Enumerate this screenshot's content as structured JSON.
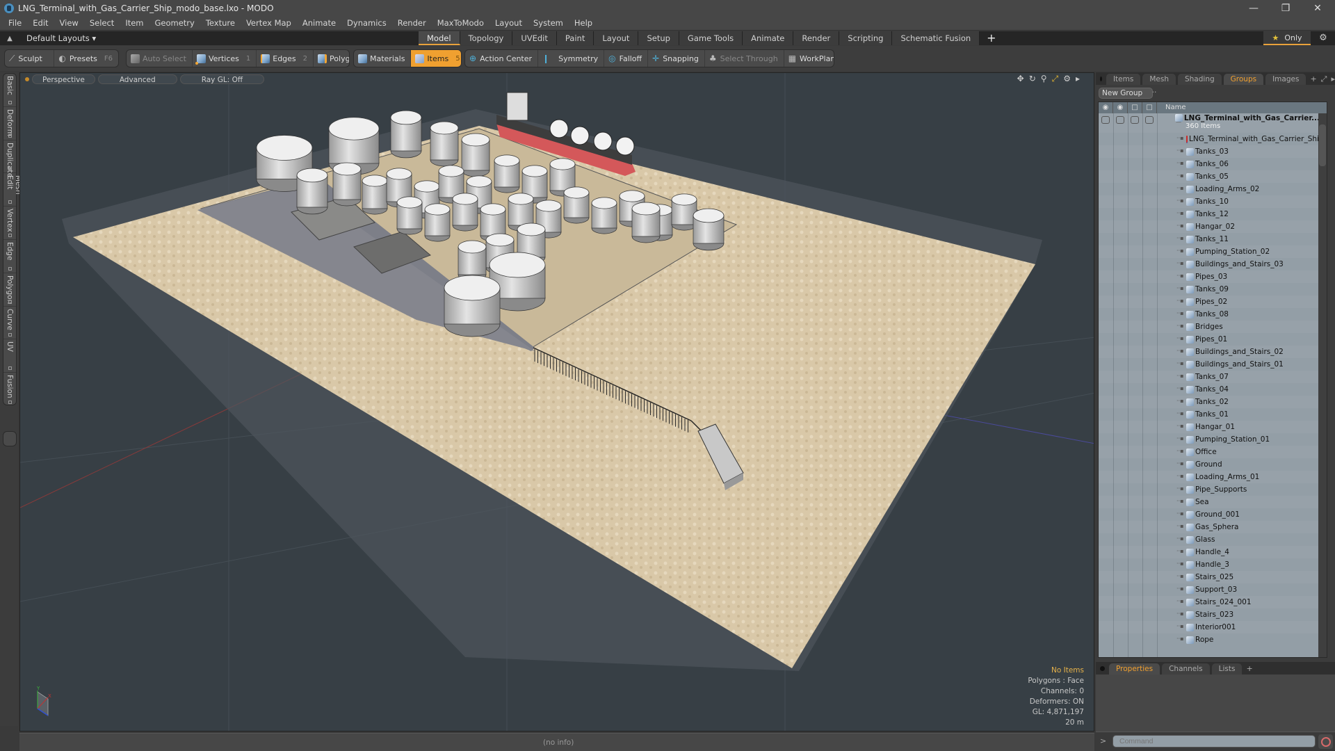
{
  "window": {
    "title": "LNG_Terminal_with_Gas_Carrier_Ship_modo_base.lxo - MODO",
    "controls": [
      "minimize",
      "restore",
      "close"
    ]
  },
  "menu": [
    "File",
    "Edit",
    "View",
    "Select",
    "Item",
    "Geometry",
    "Texture",
    "Vertex Map",
    "Animate",
    "Dynamics",
    "Render",
    "MaxToModo",
    "Layout",
    "System",
    "Help"
  ],
  "layout_bar": {
    "layouts_label": "Default Layouts",
    "tabs": [
      "Model",
      "Topology",
      "UVEdit",
      "Paint",
      "Layout",
      "Setup",
      "Game Tools",
      "Animate",
      "Render",
      "Scripting",
      "Schematic Fusion"
    ],
    "active_tab": "Model",
    "only_label": "Only"
  },
  "toolbar": {
    "sculpt": "Sculpt",
    "presets": "Presets",
    "presets_key": "F6",
    "auto_select": "Auto Select",
    "vertices": "Vertices",
    "vertices_key": "1",
    "edges": "Edges",
    "edges_key": "2",
    "polygons": "Polygons",
    "materials": "Materials",
    "items": "Items",
    "items_key": "5",
    "action_center": "Action Center",
    "symmetry": "Symmetry",
    "falloff": "Falloff",
    "snapping": "Snapping",
    "select_through": "Select Through",
    "workplane": "WorkPlane"
  },
  "left_tabs": [
    "Basic",
    "Deform",
    "Duplicate",
    "Mesh Edit",
    "Vertex",
    "Edge",
    "Polygon",
    "Curve",
    "UV",
    "Fusion"
  ],
  "viewport": {
    "view": "Perspective",
    "shading": "Advanced",
    "raygl": "Ray GL: Off",
    "info": {
      "selection": "No Items",
      "mode": "Polygons : Face",
      "channels": "Channels: 0",
      "deformers": "Deformers: ON",
      "gl": "GL: 4,871,197",
      "scale": "20 m"
    },
    "axis_labels": {
      "y": "Y",
      "x": "X",
      "z": "Z"
    }
  },
  "status": {
    "info": "(no info)"
  },
  "right_panel": {
    "tabs": [
      "Items",
      "Mesh ...",
      "Shading",
      "Groups",
      "Images"
    ],
    "active_tab": "Groups",
    "new_group": "New Group",
    "column_name": "Name",
    "root": {
      "name": "LNG_Terminal_with_Gas_Carrier...",
      "count": "360 Items"
    },
    "items": [
      "LNG_Terminal_with_Gas_Carrier_Ship",
      "Tanks_03",
      "Tanks_06",
      "Tanks_05",
      "Loading_Arms_02",
      "Tanks_10",
      "Tanks_12",
      "Hangar_02",
      "Tanks_11",
      "Pumping_Station_02",
      "Buildings_and_Stairs_03",
      "Pipes_03",
      "Tanks_09",
      "Pipes_02",
      "Tanks_08",
      "Bridges",
      "Pipes_01",
      "Buildings_and_Stairs_02",
      "Buildings_and_Stairs_01",
      "Tanks_07",
      "Tanks_04",
      "Tanks_02",
      "Tanks_01",
      "Hangar_01",
      "Pumping_Station_01",
      "Office",
      "Ground",
      "Loading_Arms_01",
      "Pipe_Supports",
      "Sea",
      "Ground_001",
      "Gas_Sphera",
      "Glass",
      "Handle_4",
      "Handle_3",
      "Stairs_025",
      "Support_03",
      "Stairs_024_001",
      "Stairs_023",
      "Interior001",
      "Rope"
    ],
    "bottom_tabs": [
      "Properties",
      "Channels",
      "Lists"
    ],
    "active_bottom_tab": "Properties",
    "command_placeholder": "Command"
  },
  "colors": {
    "accent": "#f0a030",
    "viewport_bg": "#373f45",
    "ground": "#d8c7a8",
    "panel": "#939ea6"
  }
}
